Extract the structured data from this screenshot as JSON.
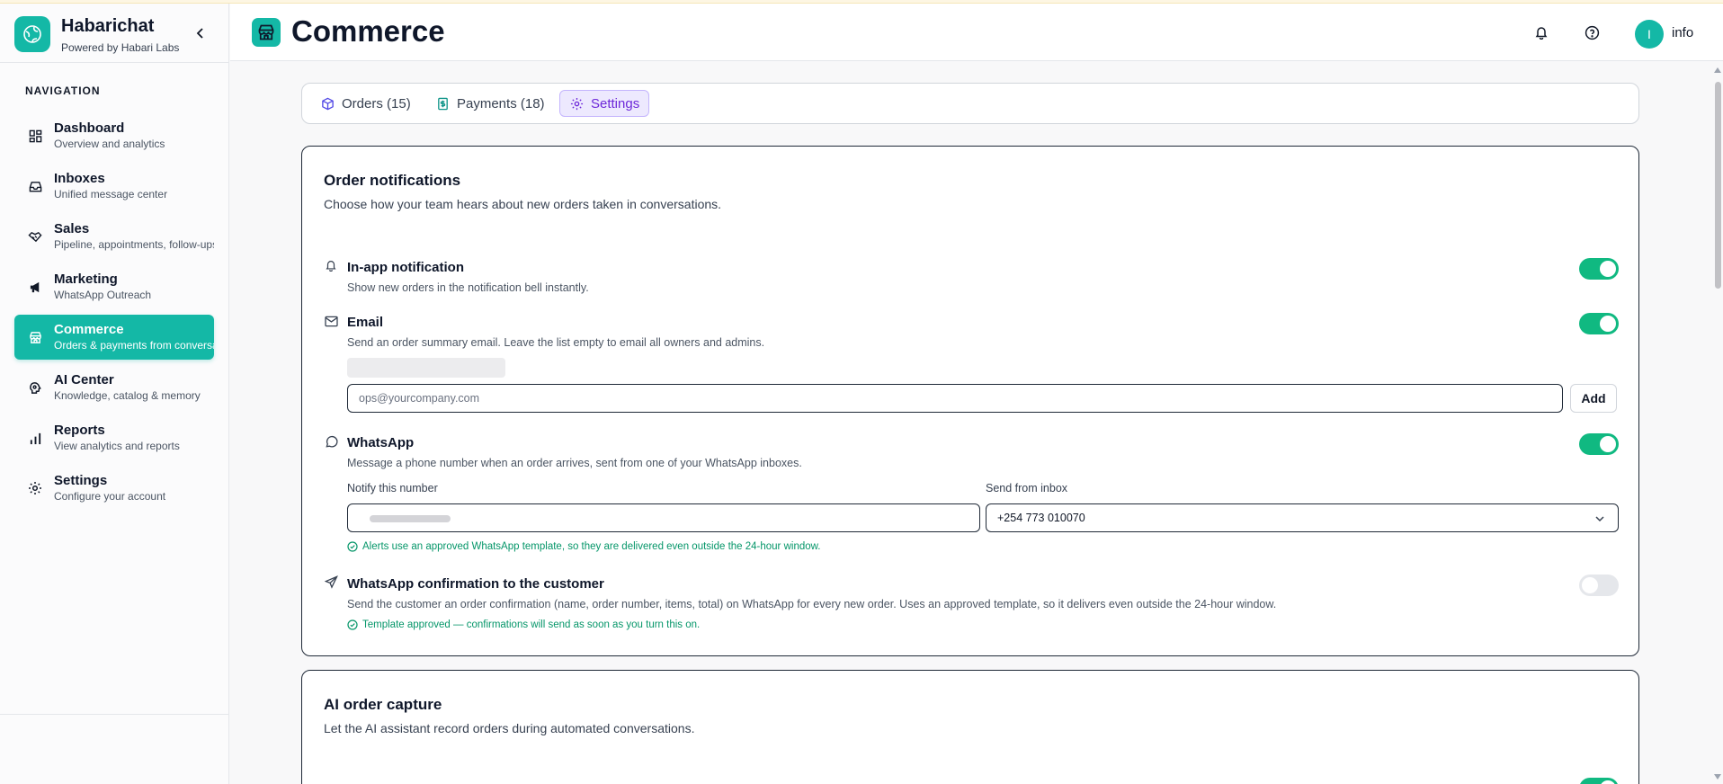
{
  "brand": {
    "name": "Habarichat",
    "subtitle": "Powered by Habari Labs"
  },
  "sidebar": {
    "heading": "NAVIGATION",
    "items": [
      {
        "label": "Dashboard",
        "sub": "Overview and analytics",
        "icon": "dashboard-icon"
      },
      {
        "label": "Inboxes",
        "sub": "Unified message center",
        "icon": "inbox-icon"
      },
      {
        "label": "Sales",
        "sub": "Pipeline, appointments, follow-ups",
        "icon": "handshake-icon"
      },
      {
        "label": "Marketing",
        "sub": "WhatsApp Outreach",
        "icon": "megaphone-icon"
      },
      {
        "label": "Commerce",
        "sub": "Orders & payments from conversations",
        "icon": "store-icon",
        "active": true
      },
      {
        "label": "AI Center",
        "sub": "Knowledge, catalog & memory",
        "icon": "ai-brain-icon"
      },
      {
        "label": "Reports",
        "sub": "View analytics and reports",
        "icon": "bar-chart-icon"
      },
      {
        "label": "Settings",
        "sub": "Configure your account",
        "icon": "gear-icon"
      }
    ]
  },
  "header": {
    "title": "Commerce",
    "user": {
      "initial": "I",
      "name": "info"
    }
  },
  "tabs": [
    {
      "label": "Orders (15)",
      "icon": "package-icon"
    },
    {
      "label": "Payments (18)",
      "icon": "receipt-icon"
    },
    {
      "label": "Settings",
      "icon": "gear-icon",
      "active": true
    }
  ],
  "order_notifications": {
    "title": "Order notifications",
    "description": "Choose how your team hears about new orders taken in conversations.",
    "in_app": {
      "title": "In-app notification",
      "description": "Show new orders in the notification bell instantly.",
      "enabled": true
    },
    "email": {
      "title": "Email",
      "description": "Send an order summary email. Leave the list empty to email all owners and admins.",
      "enabled": true,
      "placeholder": "ops@yourcompany.com",
      "add_label": "Add"
    },
    "whatsapp": {
      "title": "WhatsApp",
      "description": "Message a phone number when an order arrives, sent from one of your WhatsApp inboxes.",
      "enabled": true,
      "notify_label": "Notify this number",
      "inbox_label": "Send from inbox",
      "inbox_value": "+254 773 010070",
      "note": "Alerts use an approved WhatsApp template, so they are delivered even outside the 24-hour window."
    },
    "confirmation": {
      "title": "WhatsApp confirmation to the customer",
      "description": "Send the customer an order confirmation (name, order number, items, total) on WhatsApp for every new order. Uses an approved template, so it delivers even outside the 24-hour window.",
      "enabled": false,
      "note": "Template approved — confirmations will send as soon as you turn this on."
    }
  },
  "ai_capture": {
    "title": "AI order capture",
    "description": "Let the AI assistant record orders during automated conversations."
  },
  "colors": {
    "accent": "#14b8a6",
    "toggle_on": "#10b981",
    "active_tab": "#6d28d9",
    "success_text": "#059669"
  }
}
